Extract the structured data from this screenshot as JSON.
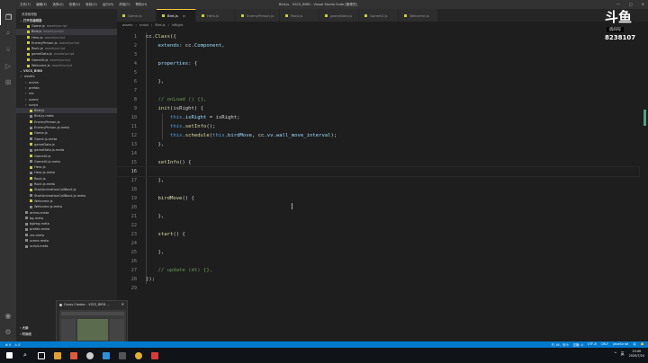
{
  "titlebar": {
    "menus": [
      "文件(F)",
      "编辑(E)",
      "选择(S)",
      "查看(V)",
      "转到(G)",
      "运行(R)",
      "终端(T)",
      "帮助(H)"
    ],
    "window_title": "Bird.js - VSCS_BIRD - Visual Studio Code [管理员]"
  },
  "sidebar": {
    "header": "资源管理器",
    "open_editors_label": "打开的编辑器",
    "open_files": [
      {
        "name": "Game.js",
        "suffix": "assets\\script"
      },
      {
        "name": "Bird.js",
        "suffix": "assets\\script",
        "selected": true
      },
      {
        "name": "Hero.js",
        "suffix": "assets\\script"
      },
      {
        "name": "EnemyPerson.js",
        "suffix": "assets\\script"
      },
      {
        "name": "Rock.js",
        "suffix": "assets\\script"
      },
      {
        "name": "gameData.js",
        "suffix": "assets\\script"
      },
      {
        "name": "GameUI.js",
        "suffix": "assets\\script"
      },
      {
        "name": "Welcome.js",
        "suffix": "assets\\script"
      }
    ],
    "project_label": "VSCS_BIRD",
    "tree": [
      {
        "name": "assets",
        "folder": true,
        "depth": 1
      },
      {
        "name": "anims",
        "folder": true,
        "depth": 2
      },
      {
        "name": "prefab",
        "folder": true,
        "depth": 2
      },
      {
        "name": "res",
        "folder": true,
        "depth": 2
      },
      {
        "name": "scene",
        "folder": true,
        "depth": 2
      },
      {
        "name": "script",
        "folder": true,
        "depth": 2
      },
      {
        "name": "Bird.js",
        "depth": 3,
        "selected": true
      },
      {
        "name": "Bird.js.meta",
        "depth": 3
      },
      {
        "name": "EnemyPerson.js",
        "depth": 3
      },
      {
        "name": "EnemyPerson.js.meta",
        "depth": 3
      },
      {
        "name": "Game.js",
        "depth": 3
      },
      {
        "name": "Game.js.meta",
        "depth": 3
      },
      {
        "name": "gameData.js",
        "depth": 3
      },
      {
        "name": "gameData.js.meta",
        "depth": 3
      },
      {
        "name": "GameUI.js",
        "depth": 3
      },
      {
        "name": "GameUI.js.meta",
        "depth": 3
      },
      {
        "name": "Hero.js",
        "depth": 3
      },
      {
        "name": "Hero.js.meta",
        "depth": 3
      },
      {
        "name": "Rock.js",
        "depth": 3
      },
      {
        "name": "Rock.js.meta",
        "depth": 3
      },
      {
        "name": "StartAnimationCallBack.js",
        "depth": 3
      },
      {
        "name": "StartAnimationCallBack.js.meta",
        "depth": 3
      },
      {
        "name": "Welcome.js",
        "depth": 3
      },
      {
        "name": "Welcome.js.meta",
        "depth": 3
      },
      {
        "name": "anims.meta",
        "depth": 2
      },
      {
        "name": "bg.meta",
        "depth": 2
      },
      {
        "name": "bgimg.meta",
        "depth": 2
      },
      {
        "name": "prefab.meta",
        "depth": 2
      },
      {
        "name": "res.meta",
        "depth": 2
      },
      {
        "name": "scene.meta",
        "depth": 2
      },
      {
        "name": "script.meta",
        "depth": 2
      }
    ],
    "outline_label": "大纲",
    "timeline_label": "时间线"
  },
  "tabs": [
    {
      "label": "Game.js"
    },
    {
      "label": "Bird.js",
      "active": true
    },
    {
      "label": "Hero.js"
    },
    {
      "label": "EnemyPerson.js"
    },
    {
      "label": "Rock.js"
    },
    {
      "label": "gameData.js"
    },
    {
      "label": "GameUI.js"
    },
    {
      "label": "Welcome.js"
    }
  ],
  "breadcrumbs": [
    "assets",
    "script",
    "Bird.js",
    "isRight"
  ],
  "code_lines": [
    {
      "n": "1",
      "tokens": [
        [
          "cc.",
          "plain"
        ],
        [
          "Class",
          "fn"
        ],
        [
          "({",
          "pun"
        ]
      ]
    },
    {
      "n": "2",
      "tokens": [
        [
          "    ",
          "plain"
        ],
        [
          "extends",
          "prop"
        ],
        [
          ": cc.",
          "plain"
        ],
        [
          "Component",
          "prop"
        ],
        [
          ",",
          "pun"
        ]
      ]
    },
    {
      "n": "3",
      "tokens": []
    },
    {
      "n": "4",
      "tokens": [
        [
          "    ",
          "plain"
        ],
        [
          "properties",
          "prop"
        ],
        [
          ": {",
          "pun"
        ]
      ]
    },
    {
      "n": "5",
      "tokens": []
    },
    {
      "n": "6",
      "tokens": [
        [
          "    },",
          "pun"
        ]
      ]
    },
    {
      "n": "7",
      "tokens": []
    },
    {
      "n": "8",
      "tokens": [
        [
          "    ",
          "plain"
        ],
        [
          "// onLoad () {},",
          "cmt"
        ]
      ]
    },
    {
      "n": "9",
      "tokens": [
        [
          "    ",
          "plain"
        ],
        [
          "init",
          "fn"
        ],
        [
          "(isRight) {",
          "plain"
        ]
      ]
    },
    {
      "n": "10",
      "tokens": [
        [
          "        ",
          "plain"
        ],
        [
          "this",
          "kw"
        ],
        [
          ".",
          "pun"
        ],
        [
          "isRight",
          "prop"
        ],
        [
          " = isRight;",
          "plain"
        ]
      ]
    },
    {
      "n": "11",
      "tokens": [
        [
          "        ",
          "plain"
        ],
        [
          "this",
          "kw"
        ],
        [
          ".",
          "pun"
        ],
        [
          "setInfo",
          "fn"
        ],
        [
          "();",
          "pun"
        ]
      ]
    },
    {
      "n": "12",
      "tokens": [
        [
          "        ",
          "plain"
        ],
        [
          "this",
          "kw"
        ],
        [
          ".",
          "pun"
        ],
        [
          "schedule",
          "fn"
        ],
        [
          "(",
          "pun"
        ],
        [
          "this",
          "kw"
        ],
        [
          ".",
          "pun"
        ],
        [
          "birdMove",
          "prop"
        ],
        [
          ", cc.",
          "plain"
        ],
        [
          "vv",
          "prop"
        ],
        [
          ".",
          "pun"
        ],
        [
          "wall_move_interval",
          "prop"
        ],
        [
          ");",
          "pun"
        ]
      ]
    },
    {
      "n": "13",
      "tokens": [
        [
          "    },",
          "pun"
        ]
      ]
    },
    {
      "n": "14",
      "tokens": []
    },
    {
      "n": "15",
      "tokens": [
        [
          "    ",
          "plain"
        ],
        [
          "setInfo",
          "fn"
        ],
        [
          "() {",
          "pun"
        ]
      ]
    },
    {
      "n": "16",
      "tokens": []
    },
    {
      "n": "17",
      "tokens": [
        [
          "    },",
          "pun"
        ]
      ]
    },
    {
      "n": "18",
      "tokens": []
    },
    {
      "n": "19",
      "tokens": [
        [
          "    ",
          "plain"
        ],
        [
          "birdMove",
          "fn"
        ],
        [
          "() {",
          "pun"
        ]
      ]
    },
    {
      "n": "20",
      "tokens": []
    },
    {
      "n": "21",
      "tokens": [
        [
          "    },",
          "pun"
        ]
      ]
    },
    {
      "n": "22",
      "tokens": []
    },
    {
      "n": "23",
      "tokens": [
        [
          "    ",
          "plain"
        ],
        [
          "start",
          "fn"
        ],
        [
          "() {",
          "pun"
        ]
      ]
    },
    {
      "n": "24",
      "tokens": []
    },
    {
      "n": "25",
      "tokens": [
        [
          "    },",
          "pun"
        ]
      ]
    },
    {
      "n": "26",
      "tokens": []
    },
    {
      "n": "27",
      "tokens": [
        [
          "    ",
          "plain"
        ],
        [
          "// update (dt) {},",
          "cmt"
        ]
      ]
    },
    {
      "n": "28",
      "tokens": [
        [
          "});",
          "pun"
        ]
      ]
    },
    {
      "n": "29",
      "tokens": []
    }
  ],
  "current_line": "16",
  "overlay": {
    "logo": "斗鱼",
    "room_label": "房间号",
    "room_number": "8238107"
  },
  "popup": {
    "title": "Cocos Creator - VSCS_BIRD ..."
  },
  "statusbar": {
    "left": [
      "⊗ 0",
      "⚠ 0"
    ],
    "right": [
      "行 16，列 9",
      "空格: 4",
      "UTF-8",
      "CRLF",
      "JavaScript",
      "☺",
      "🔔"
    ]
  },
  "taskbar": {
    "clock_time": "15:40",
    "clock_date": "2020/7/24",
    "tray": [
      "^",
      "英"
    ]
  },
  "colors": {
    "accent": "#007acc",
    "active_tab_border": "#f5c542",
    "js_icon": "#cbcb41"
  }
}
